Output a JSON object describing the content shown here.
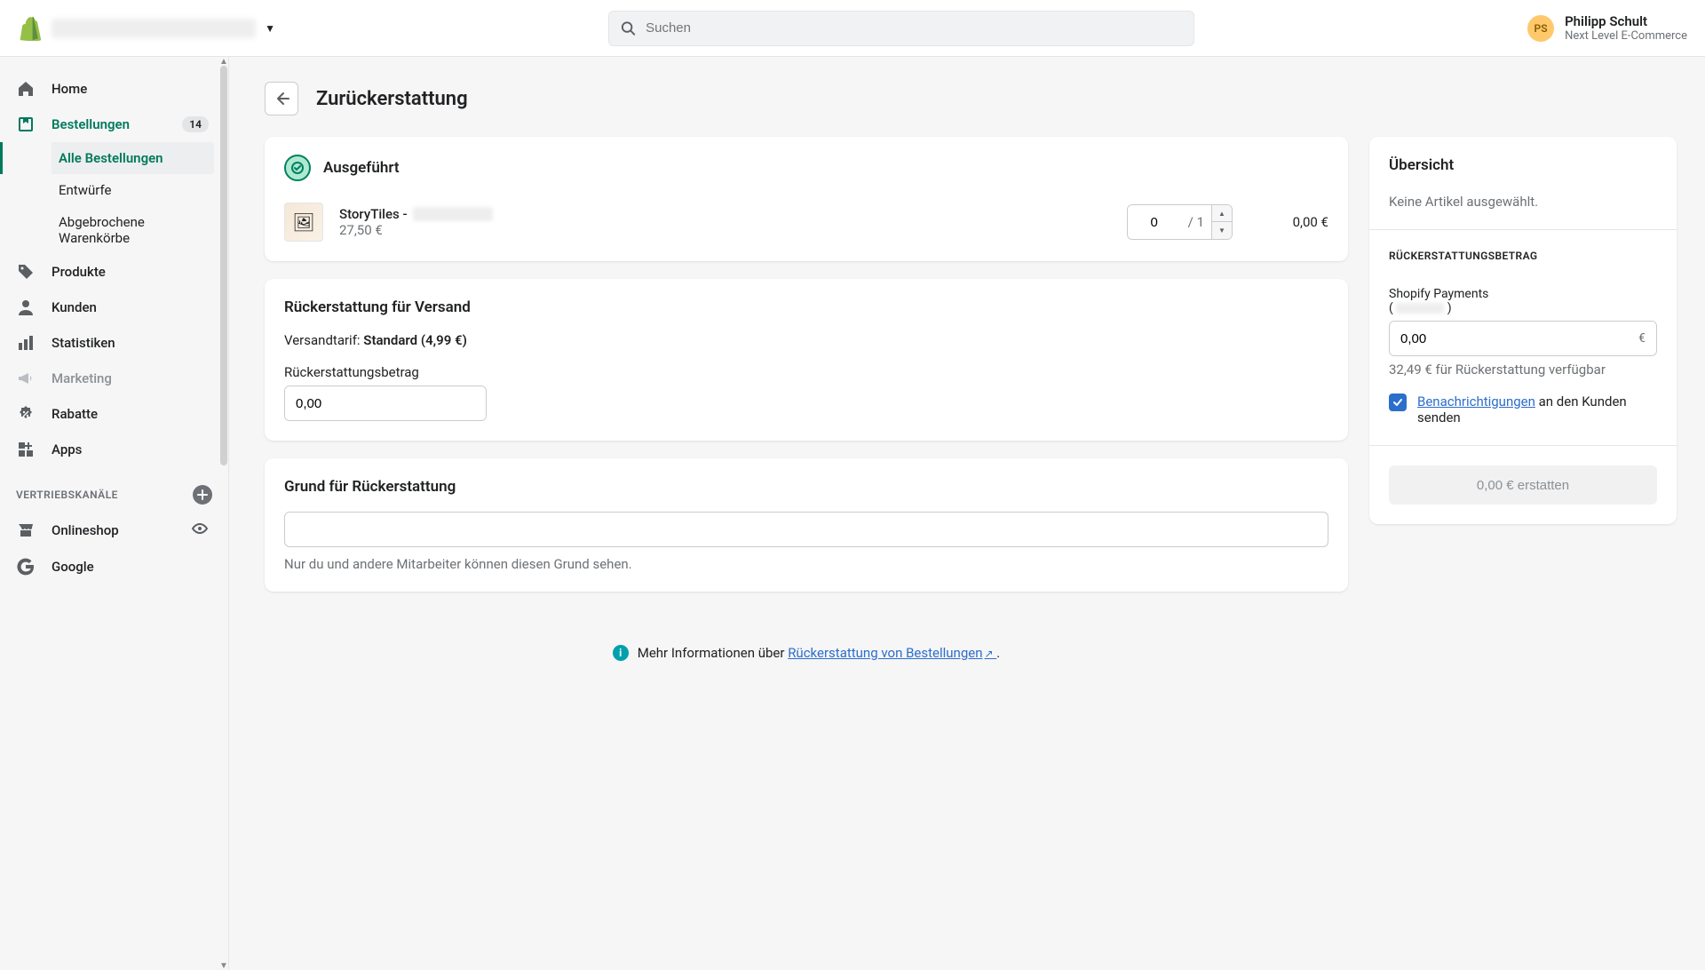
{
  "topbar": {
    "search_placeholder": "Suchen",
    "user_initials": "PS",
    "user_name": "Philipp Schult",
    "user_company": "Next Level E-Commerce"
  },
  "sidebar": {
    "items": {
      "home": "Home",
      "orders": "Bestellungen",
      "orders_badge": "14",
      "all_orders": "Alle Bestellungen",
      "drafts": "Entwürfe",
      "abandoned": "Abgebrochene Warenkörbe",
      "products": "Produkte",
      "customers": "Kunden",
      "analytics": "Statistiken",
      "marketing": "Marketing",
      "discounts": "Rabatte",
      "apps": "Apps"
    },
    "channels_header": "VERTRIEBSKANÄLE",
    "channels": {
      "onlinestore": "Onlineshop",
      "google": "Google"
    }
  },
  "page": {
    "title": "Zurückerstattung"
  },
  "fulfilled": {
    "status": "Ausgeführt",
    "item_name": "StoryTiles -",
    "item_price": "27,50 €",
    "qty_value": "0",
    "qty_max": "/ 1",
    "line_total": "0,00 €"
  },
  "shipping": {
    "section_title": "Rückerstattung für Versand",
    "rate_label": "Versandtarif:",
    "rate_name": "Standard",
    "rate_price": "(4,99 €)",
    "amount_label": "Rückerstattungsbetrag",
    "amount_value": "0,00",
    "currency": "€"
  },
  "reason": {
    "section_title": "Grund für Rückerstattung",
    "helper": "Nur du und andere Mitarbeiter können diesen Grund sehen."
  },
  "info": {
    "text_prefix": "Mehr Informationen über ",
    "link": "Rückerstattung von Bestellungen",
    "suffix": " ."
  },
  "summary": {
    "title": "Übersicht",
    "empty": "Keine Artikel ausgewählt.",
    "amount_caps": "RÜCKERSTATTUNGSBETRAG",
    "gateway": "Shopify Payments",
    "input_value": "0,00",
    "currency": "€",
    "available": "32,49 € für Rückerstattung verfügbar",
    "notify_link": "Benachrichtigungen",
    "notify_rest": " an den Kunden senden",
    "button": "0,00 € erstatten"
  }
}
